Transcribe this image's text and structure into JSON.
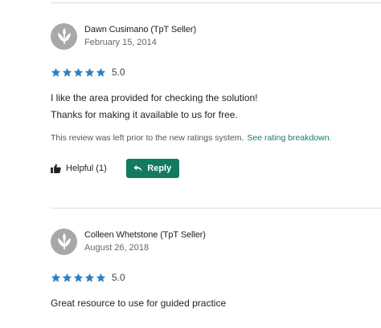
{
  "reviews": [
    {
      "author": "Dawn Cusimano (TpT Seller)",
      "date": "February 15, 2014",
      "stars": 5,
      "rating": "5.0",
      "body_lines": [
        "I like the area provided for checking the solution!",
        "Thanks for making it available to us for free."
      ],
      "note": "This review was left prior to the new ratings system.",
      "note_link": "See rating breakdown.",
      "helpful_label": "Helpful (1)",
      "reply_label": "Reply"
    },
    {
      "author": "Colleen Whetstone (TpT Seller)",
      "date": "August 26, 2018",
      "stars": 5,
      "rating": "5.0",
      "body_lines": [
        "Great resource to use for guided practice"
      ]
    }
  ],
  "colors": {
    "star": "#2f7fbf",
    "accent_green": "#137a62",
    "link_green": "#137a73",
    "avatar_gray": "#a8a8a8"
  },
  "icons": {
    "avatar": "tpt-leaf-avatar-icon",
    "star": "star-icon",
    "helpful": "thumbs-up-icon",
    "reply": "reply-arrow-icon"
  }
}
